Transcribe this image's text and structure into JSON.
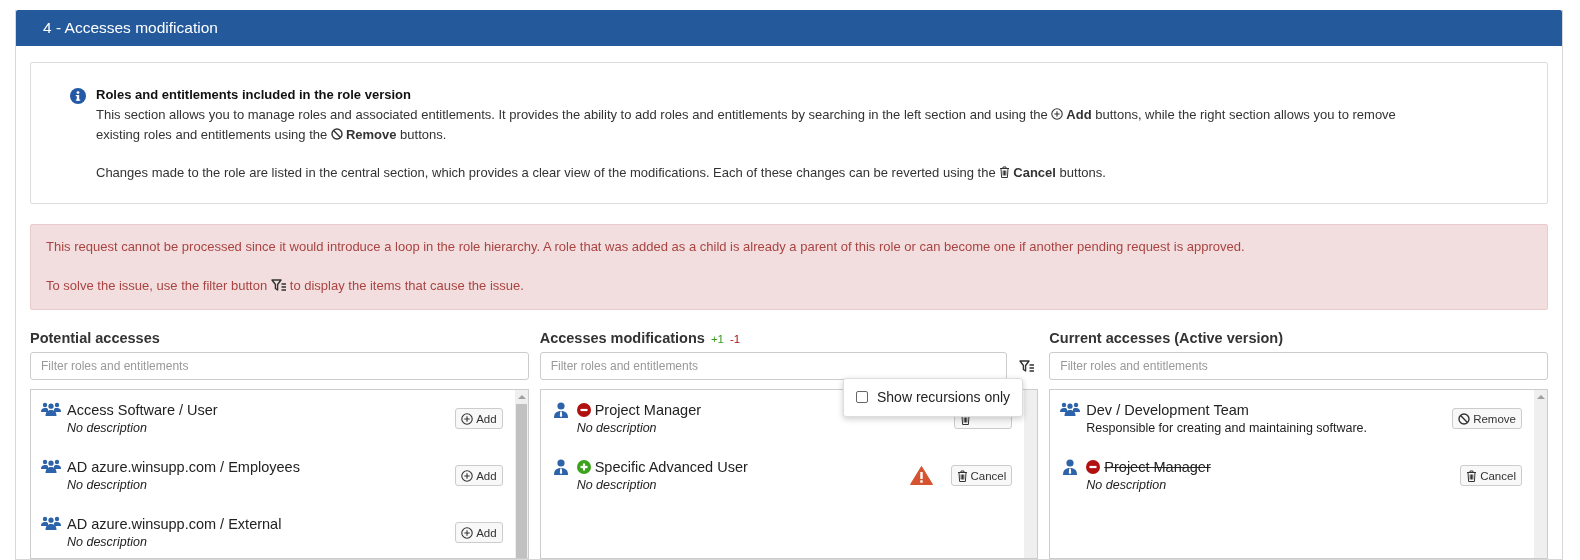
{
  "section": {
    "title": "4 - Accesses modification"
  },
  "info": {
    "title": "Roles and entitlements included in the role version",
    "paragraphs": [
      [
        [
          {
            "text": "This section allows you to manage roles and associated entitlements. It provides the ability to add roles and entitlements by searching in the left section and using the"
          },
          {
            "kind": "add"
          },
          {
            "text": "**Add** buttons, while the right section allows you to remove"
          }
        ],
        [
          {
            "text": "existing roles and entitlements using the"
          },
          {
            "kind": "remove"
          },
          {
            "text": "**Remove** buttons."
          }
        ]
      ],
      [
        [
          {
            "text": "Changes made to the role are listed in the central section, which provides a clear view of the modifications. Each of these changes can be reverted using the"
          },
          {
            "kind": "cancel"
          },
          {
            "text": "**Cancel** buttons."
          }
        ]
      ]
    ]
  },
  "alert": {
    "paragraphs": [
      [
        [
          {
            "text": "This request cannot be processed since it would introduce a loop in the role hierarchy. A role that was added as a child is already a parent of this role or can become one if another pending request is approved."
          }
        ]
      ],
      [
        [
          {
            "text": "To solve the issue, use the filter button"
          },
          {
            "kind": "filter"
          },
          {
            "text": "to display the items that cause the issue."
          }
        ]
      ]
    ]
  },
  "columns": [
    {
      "title": "Potential accesses",
      "filter": {
        "placeholder": "Filter roles and entitlements"
      },
      "filter_button": false,
      "items": [
        {
          "kind": "group",
          "added": false,
          "removed": false,
          "title": "Access Software / User",
          "description": "No description",
          "placeholder_description": true,
          "struck": false,
          "warning": false,
          "button": {
            "kind": "add",
            "label": "Add"
          }
        },
        {
          "kind": "group",
          "added": false,
          "removed": false,
          "title": "AD azure.winsupp.com / Employees",
          "description": "No description",
          "placeholder_description": true,
          "struck": false,
          "warning": false,
          "button": {
            "kind": "add",
            "label": "Add"
          }
        },
        {
          "kind": "group",
          "added": false,
          "removed": false,
          "title": "AD azure.winsupp.com / External",
          "description": "No description",
          "placeholder_description": true,
          "struck": false,
          "warning": false,
          "button": {
            "kind": "add",
            "label": "Add"
          }
        }
      ]
    },
    {
      "title": "Accesses modifications",
      "counts": [
        {
          "text": "+1",
          "kind": "added"
        },
        {
          "text": "-1",
          "kind": "removed"
        }
      ],
      "filter": {
        "placeholder": "Filter roles and entitlements"
      },
      "filter_button": true,
      "items": [
        {
          "kind": "user",
          "added": false,
          "removed": true,
          "title": "Project Manager",
          "description": "No description",
          "placeholder_description": true,
          "struck": false,
          "warning": false,
          "button": {
            "kind": "cancel"
          }
        },
        {
          "kind": "user",
          "added": true,
          "removed": false,
          "title": "Specific Advanced User",
          "description": "No description",
          "placeholder_description": true,
          "struck": false,
          "warning": true,
          "button": {
            "kind": "cancel",
            "label": "Cancel"
          }
        }
      ]
    },
    {
      "title": "Current accesses (Active version)",
      "filter": {
        "placeholder": "Filter roles and entitlements"
      },
      "filter_button": false,
      "items": [
        {
          "kind": "group",
          "added": false,
          "removed": false,
          "title": "Dev / Development Team",
          "description": "Responsible for creating and maintaining software.",
          "placeholder_description": false,
          "struck": false,
          "warning": false,
          "button": {
            "kind": "remove",
            "label": "Remove"
          }
        },
        {
          "kind": "user",
          "added": false,
          "removed": true,
          "title": "Project Manager",
          "description": "No description",
          "placeholder_description": true,
          "struck": true,
          "warning": false,
          "button": {
            "kind": "cancel",
            "label": "Cancel"
          }
        }
      ]
    }
  ],
  "popup": {
    "label": "Show recursions only",
    "checked": false
  }
}
